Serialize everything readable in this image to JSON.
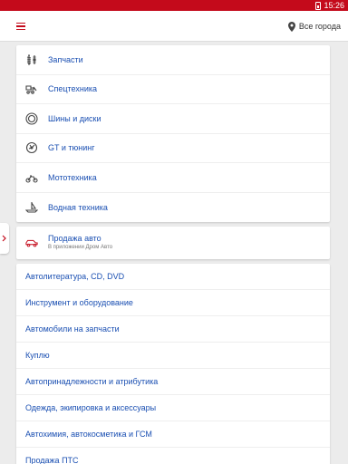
{
  "status_bar": {
    "time": "15:26"
  },
  "toolbar": {
    "city_label": "Все города"
  },
  "categories": [
    {
      "label": "Запчасти",
      "icon": "spring-icon"
    },
    {
      "label": "Спецтехника",
      "icon": "bulldozer-icon"
    },
    {
      "label": "Шины и диски",
      "icon": "tire-icon"
    },
    {
      "label": "GT и тюнинг",
      "icon": "turbo-icon"
    },
    {
      "label": "Мототехника",
      "icon": "motorcycle-icon"
    },
    {
      "label": "Водная техника",
      "icon": "boat-icon"
    }
  ],
  "car_sale": {
    "title": "Продажа авто",
    "subtitle": "В приложении Дром Авто",
    "icon": "car-icon"
  },
  "links": [
    "Автолитература, CD, DVD",
    "Инструмент и оборудование",
    "Автомобили на запчасти",
    "Куплю",
    "Автопринадлежности и атрибутика",
    "Одежда, экипировка и аксессуары",
    "Автохимия, автокосметика и ГСМ",
    "Продажа ПТС"
  ],
  "colors": {
    "brand_red": "#c40a1b",
    "link_blue": "#1a4fb2"
  }
}
